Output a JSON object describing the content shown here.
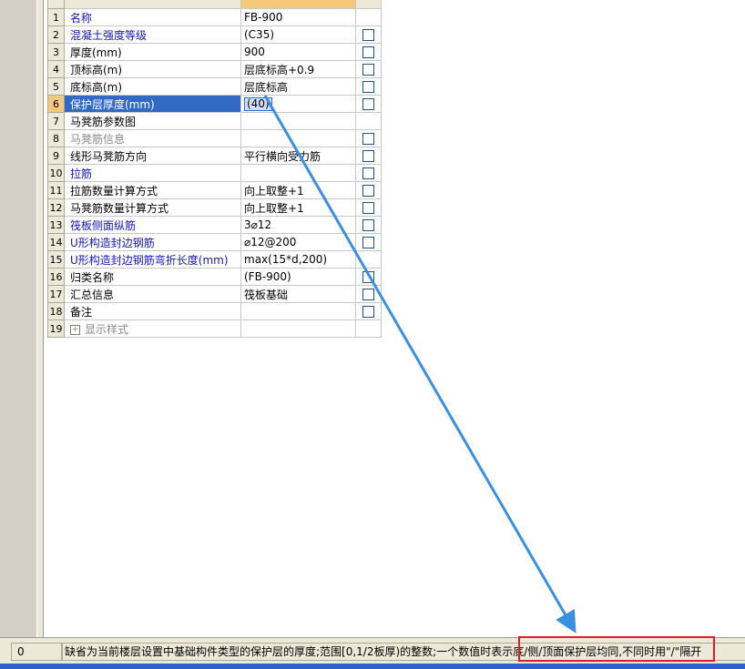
{
  "rows": [
    {
      "num": "1",
      "name": "名称",
      "value": "FB-900",
      "style": "blue",
      "check": false
    },
    {
      "num": "2",
      "name": "混凝土强度等级",
      "value": "(C35)",
      "style": "blue",
      "check": true
    },
    {
      "num": "3",
      "name": "厚度(mm)",
      "value": "900",
      "style": "",
      "check": true
    },
    {
      "num": "4",
      "name": "顶标高(m)",
      "value": "层底标高+0.9",
      "style": "",
      "check": true
    },
    {
      "num": "5",
      "name": "底标高(m)",
      "value": "层底标高",
      "style": "",
      "check": true
    },
    {
      "num": "6",
      "name": "保护层厚度(mm)",
      "value": "(40)",
      "style": "selected",
      "check": true
    },
    {
      "num": "7",
      "name": "马凳筋参数图",
      "value": "",
      "style": "",
      "check": false
    },
    {
      "num": "8",
      "name": "马凳筋信息",
      "value": "",
      "style": "gray",
      "check": true
    },
    {
      "num": "9",
      "name": "线形马凳筋方向",
      "value": "平行横向受力筋",
      "style": "",
      "check": true
    },
    {
      "num": "10",
      "name": "拉筋",
      "value": "",
      "style": "blue",
      "check": true
    },
    {
      "num": "11",
      "name": "拉筋数量计算方式",
      "value": "向上取整+1",
      "style": "",
      "check": true
    },
    {
      "num": "12",
      "name": "马凳筋数量计算方式",
      "value": "向上取整+1",
      "style": "",
      "check": true
    },
    {
      "num": "13",
      "name": "筏板侧面纵筋",
      "value": "3⌀12",
      "style": "blue",
      "check": true
    },
    {
      "num": "14",
      "name": "U形构造封边钢筋",
      "value": "⌀12@200",
      "style": "blue",
      "check": true
    },
    {
      "num": "15",
      "name": "U形构造封边钢筋弯折长度(mm)",
      "value": "max(15*d,200)",
      "style": "blue",
      "check": false
    },
    {
      "num": "16",
      "name": "归类名称",
      "value": "(FB-900)",
      "style": "",
      "check": true
    },
    {
      "num": "17",
      "name": "汇总信息",
      "value": "筏板基础",
      "style": "",
      "check": true
    },
    {
      "num": "18",
      "name": "备注",
      "value": "",
      "style": "",
      "check": true
    },
    {
      "num": "19",
      "name": "显示样式",
      "value": "",
      "style": "gray-expand",
      "check": false
    }
  ],
  "status": {
    "cell0": "0",
    "text": "缺省为当前楼层设置中基础构件类型的保护层的厚度;范围[0,1/2板厚)的整数;一个数值时表示底/侧/顶面保护层均同,不同时用\"/\"隔开"
  },
  "icons": {
    "expand": "plus-expand-icon",
    "checkbox": "checkbox-icon"
  },
  "colors": {
    "selected_row": "#316ac5",
    "header_value": "#f5c87a",
    "annotation_arrow": "#3a8fe0",
    "annotation_box": "#e02020"
  }
}
